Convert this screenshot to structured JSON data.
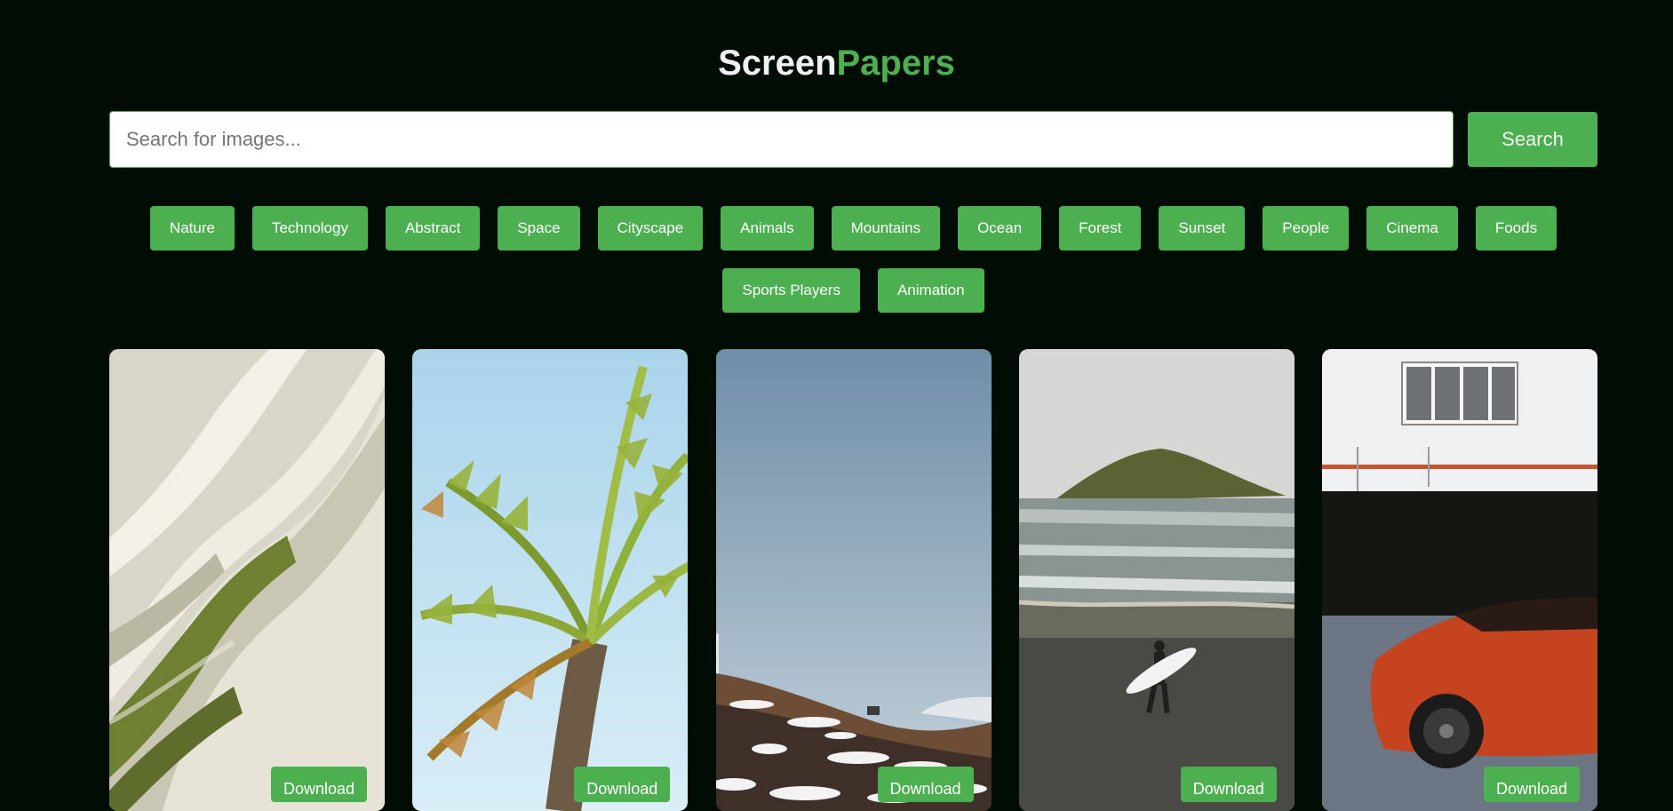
{
  "header": {
    "brand_first": "Screen",
    "brand_second": "Papers"
  },
  "search": {
    "placeholder": "Search for images...",
    "value": "",
    "button_label": "Search"
  },
  "categories": [
    "Nature",
    "Technology",
    "Abstract",
    "Space",
    "Cityscape",
    "Animals",
    "Mountains",
    "Ocean",
    "Forest",
    "Sunset",
    "People",
    "Cinema",
    "Foods",
    "Sports Players",
    "Animation"
  ],
  "gallery": {
    "download_label": "Download",
    "images": [
      "abstract-green-curves-image",
      "palm-tree-image",
      "snowy-hillside-image",
      "surfer-beach-image",
      "red-sports-car-image"
    ]
  },
  "colors": {
    "background": "#010d04",
    "accent": "#4caf50",
    "brand_primary_text": "#f1f1f1"
  }
}
